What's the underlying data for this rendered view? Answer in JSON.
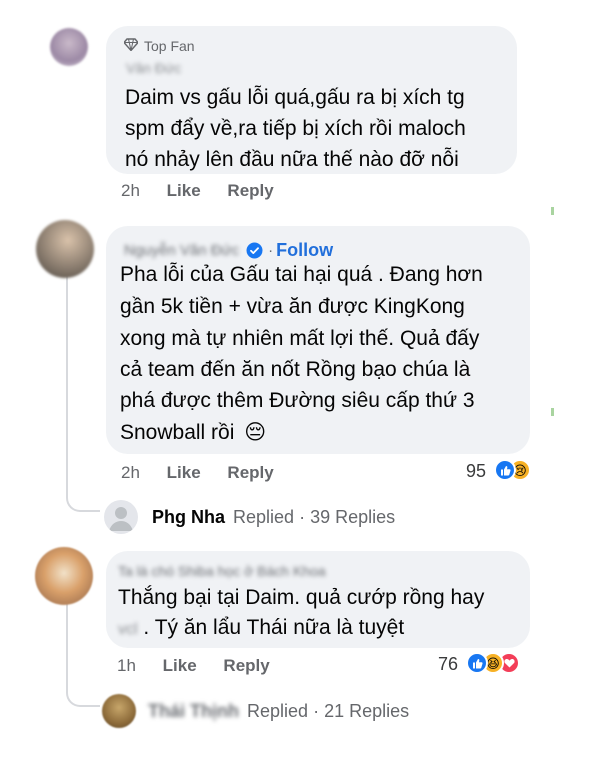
{
  "comments": [
    {
      "badge": "Top Fan",
      "author": "Văn Đức",
      "lines": [
        "Daim vs gấu lỗi quá,gấu ra bị xích tg",
        "spm đẩy về,ra tiếp bị xích rồi maloch",
        "nó nhảy lên đầu nữa thế nào đỡ nỗi"
      ],
      "time": "2h",
      "like": "Like",
      "reply": "Reply"
    },
    {
      "author": "Nguyễn Văn Đức",
      "follow": "Follow",
      "lines": [
        "Pha lỗi của Gấu tai hại quá . Đang hơn",
        "gần 5k tiền + vừa ăn được KingKong",
        "xong mà tự nhiên mất lợi thế. Quả đấy",
        "cả team đến ăn nốt Rồng bạo chúa là",
        "phá được thêm Đường siêu cấp thứ 3",
        "Snowball rồi"
      ],
      "emoji": "😔",
      "time": "2h",
      "like": "Like",
      "reply": "Reply",
      "reaction_count": "95",
      "replied_by": "Phg Nha",
      "replied_label": "Replied",
      "replies": "39 Replies"
    },
    {
      "author": "Ta là chó Shiba học ở Bách Khoa",
      "lines": [
        "Thắng bại tại Daim. quả cướp rồng hay",
        ". Tý ăn lẩu Thái nữa là tuyệt"
      ],
      "hidden_word": "vcl",
      "time": "1h",
      "like": "Like",
      "reply": "Reply",
      "reaction_count": "76",
      "replied_by": "Thái Thịnh",
      "replied_label": "Replied",
      "replies": "21 Replies"
    }
  ],
  "colors": {
    "bubble": "#f0f2f5",
    "meta": "#65676b",
    "follow": "#216fdb",
    "like_reaction": "#1877f2",
    "love_reaction": "#f33e58",
    "haha_reaction": "#f7b125"
  },
  "icons": {
    "badge": "diamond-icon",
    "verified": "verified-icon",
    "reactions_c2": [
      "like-reaction-icon",
      "sad-reaction-icon"
    ],
    "reactions_c3": [
      "like-reaction-icon",
      "haha-reaction-icon",
      "love-reaction-icon"
    ]
  }
}
